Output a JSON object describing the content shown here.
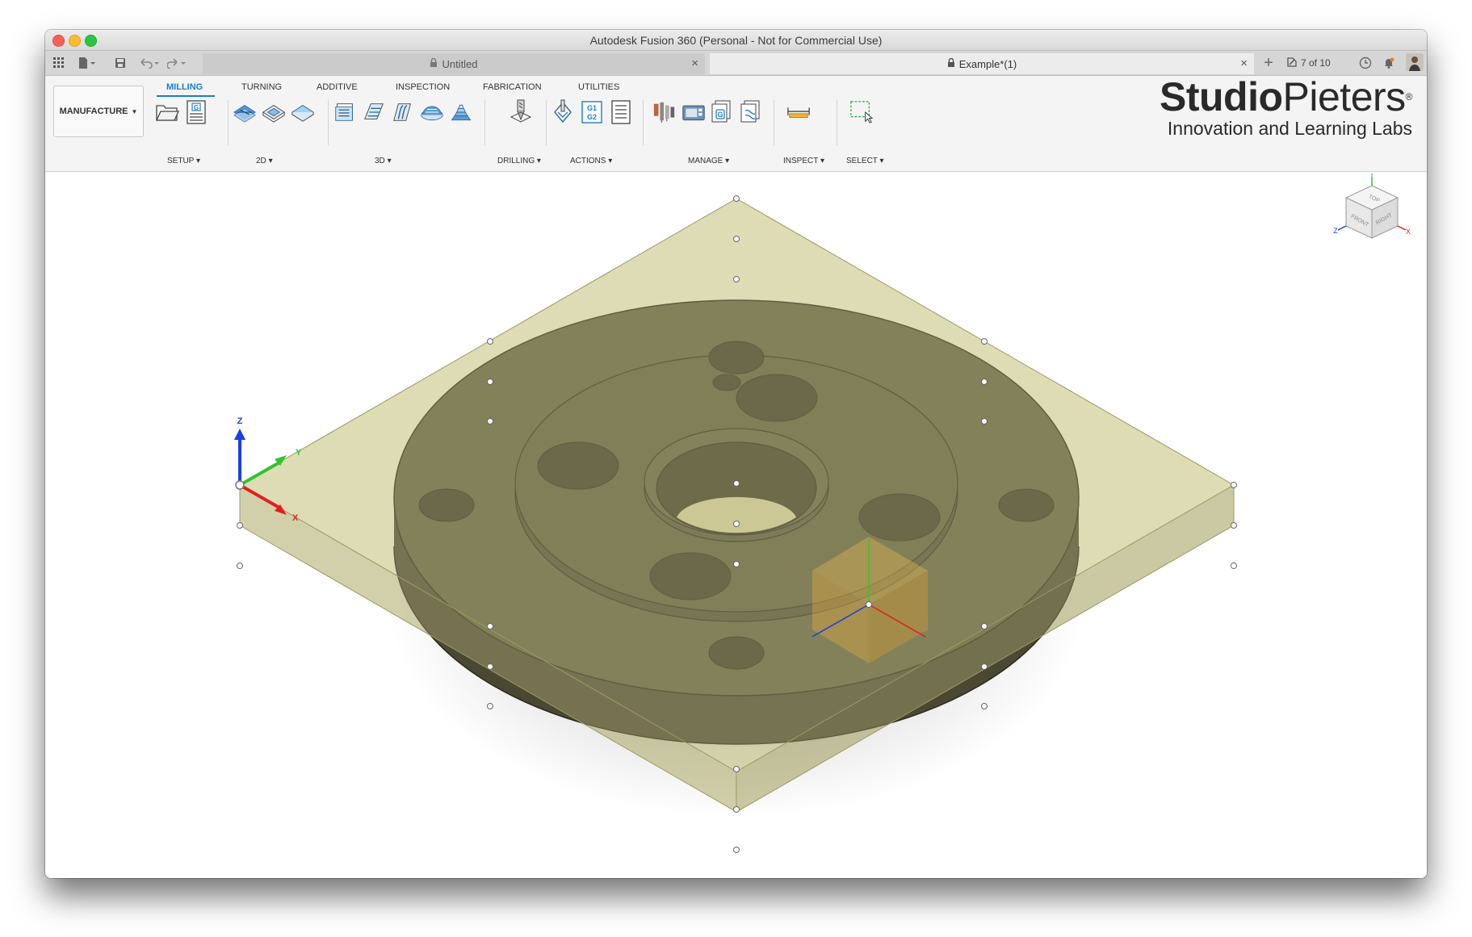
{
  "window": {
    "title": "Autodesk Fusion 360 (Personal - Not for Commercial Use)"
  },
  "tabs": {
    "inactive": {
      "label": "Untitled",
      "close": "×"
    },
    "active": {
      "label": "Example*(1)",
      "close": "×"
    },
    "new_tab": "+",
    "job_status": "7 of 10"
  },
  "toolbar_icons": [
    "apps-grid-icon",
    "file-menu-icon",
    "save-icon",
    "undo-icon",
    "redo-icon",
    "clock-icon",
    "notification-icon",
    "help-icon",
    "avatar"
  ],
  "ribbon": {
    "workspace": "MANUFACTURE",
    "tabs": [
      "MILLING",
      "TURNING",
      "ADDITIVE",
      "INSPECTION",
      "FABRICATION",
      "UTILITIES"
    ],
    "active_tab": "MILLING",
    "groups": [
      "SETUP",
      "2D",
      "3D",
      "DRILLING",
      "ACTIONS",
      "MANAGE",
      "INSPECT",
      "SELECT"
    ],
    "actions_icon_text": "G1 G2",
    "setup_icon_text": "G"
  },
  "brand": {
    "main_bold": "Studio",
    "main_regular": "Pieters",
    "registered": "®",
    "subtitle": "Innovation and Learning Labs"
  },
  "viewcube": {
    "faces": [
      "TOP",
      "FRONT",
      "RIGHT"
    ],
    "axes": [
      "X",
      "Y",
      "Z"
    ]
  },
  "triad": {
    "x": "X",
    "y": "Y",
    "z": "Z"
  },
  "colors": {
    "accent": "#1b7bd0",
    "stock_fill": "#b8b56f",
    "part_fill": "#5c5a3a",
    "axis_x": "#e02020",
    "axis_y": "#2ec52e",
    "axis_z": "#1a3fe0"
  }
}
